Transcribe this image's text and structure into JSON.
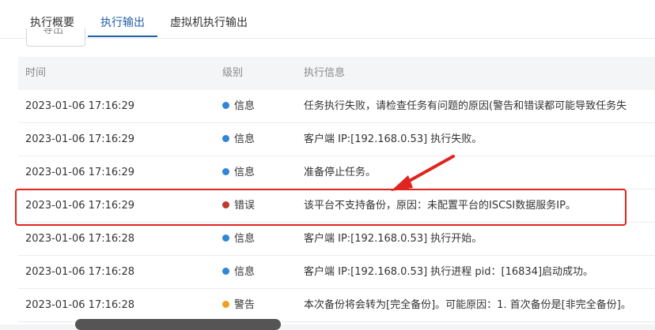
{
  "tabs": [
    {
      "label": "执行概要"
    },
    {
      "label": "执行输出"
    },
    {
      "label": "虚拟机执行输出"
    }
  ],
  "partial_button": {
    "label": "导出"
  },
  "table": {
    "headers": {
      "time": "时间",
      "level": "级别",
      "message": "执行信息"
    },
    "rows": [
      {
        "time": "2023-01-06 17:16:29",
        "level": "信息",
        "level_color": "#2f86d6",
        "message": "任务执行失败，请检查任务有问题的原因(警告和错误都可能导致任务失"
      },
      {
        "time": "2023-01-06 17:16:29",
        "level": "信息",
        "level_color": "#2f86d6",
        "message": "客户端 IP:[192.168.0.53] 执行失败。"
      },
      {
        "time": "2023-01-06 17:16:29",
        "level": "信息",
        "level_color": "#2f86d6",
        "message": "准备停止任务。"
      },
      {
        "time": "2023-01-06 17:16:29",
        "level": "错误",
        "level_color": "#c0392b",
        "message": "该平台不支持备份，原因：未配置平台的ISCSI数据服务IP。"
      },
      {
        "time": "2023-01-06 17:16:28",
        "level": "信息",
        "level_color": "#2f86d6",
        "message": "客户端 IP:[192.168.0.53] 执行开始。"
      },
      {
        "time": "2023-01-06 17:16:28",
        "level": "信息",
        "level_color": "#2f86d6",
        "message": "客户端 IP:[192.168.0.53] 执行进程 pid：[16834]启动成功。"
      },
      {
        "time": "2023-01-06 17:16:28",
        "level": "警告",
        "level_color": "#f0a020",
        "message": "本次备份将会转为[完全备份]。可能原因：1. 首次备份是[非完全备份]。"
      }
    ]
  },
  "annotation_color": "#e0241f"
}
